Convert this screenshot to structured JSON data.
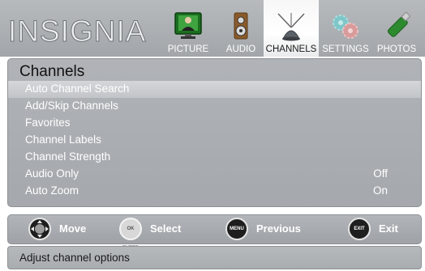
{
  "header": {
    "logo": "INSIGNIA",
    "tabs": [
      {
        "label": "PICTURE",
        "icon": "picture-tv-icon",
        "active": false
      },
      {
        "label": "AUDIO",
        "icon": "speaker-icon",
        "active": false
      },
      {
        "label": "CHANNELS",
        "icon": "antenna-icon",
        "active": true
      },
      {
        "label": "SETTINGS",
        "icon": "settings-gears-icon",
        "active": false
      },
      {
        "label": "PHOTOS",
        "icon": "usb-drive-icon",
        "active": false
      }
    ]
  },
  "menu": {
    "title": "Channels",
    "items": [
      {
        "label": "Auto Channel Search",
        "value": ""
      },
      {
        "label": "Add/Skip Channels",
        "value": ""
      },
      {
        "label": "Favorites",
        "value": ""
      },
      {
        "label": "Channel Labels",
        "value": ""
      },
      {
        "label": "Channel Strength",
        "value": ""
      },
      {
        "label": "Audio Only",
        "value": "Off"
      },
      {
        "label": "Auto Zoom",
        "value": "On"
      }
    ]
  },
  "nav": {
    "move": {
      "label": "Move",
      "icon": "dpad-icon"
    },
    "select": {
      "label": "Select",
      "icon": "ok-enter-button-icon",
      "button_text": "OK ENTER"
    },
    "previous": {
      "label": "Previous",
      "icon": "menu-button-icon",
      "button_text": "MENU"
    },
    "exit": {
      "label": "Exit",
      "icon": "exit-button-icon",
      "button_text": "EXIT"
    }
  },
  "help": {
    "text": "Adjust channel options"
  }
}
